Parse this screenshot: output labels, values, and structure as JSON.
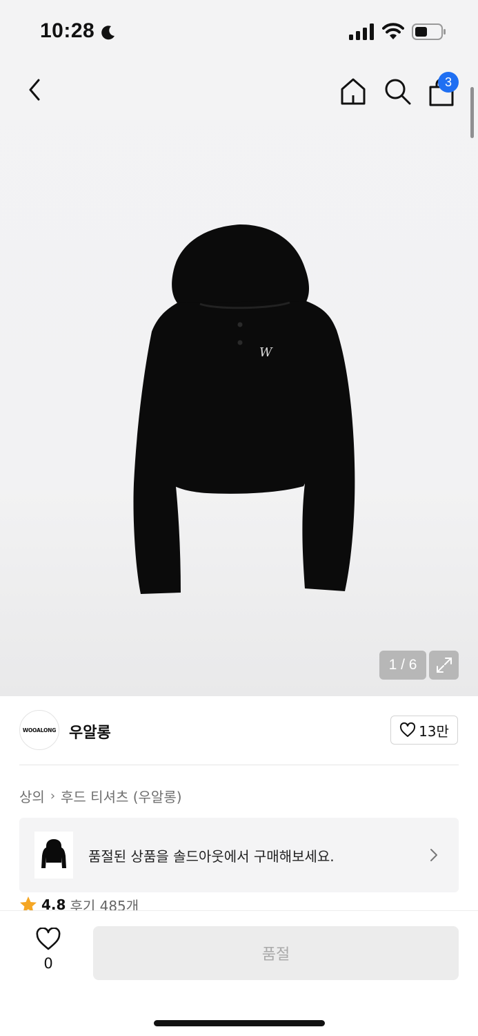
{
  "status_bar": {
    "time": "10:28",
    "icons": [
      "moon-icon",
      "signal-icon",
      "wifi-icon",
      "battery-icon"
    ]
  },
  "nav": {
    "icons": [
      "back-icon",
      "home-icon",
      "search-icon",
      "bag-icon"
    ],
    "cart_badge": "3"
  },
  "gallery": {
    "counter": "1 / 6",
    "expand_icon": "expand-icon"
  },
  "brand": {
    "logo_text": "WOOALONG",
    "name": "우알롱",
    "likes": "13만"
  },
  "breadcrumb": {
    "category": "상의",
    "subcategory": "후드 티셔츠 (우알롱)"
  },
  "soldout_banner": {
    "text": "품절된 상품을 솔드아웃에서 구매해보세요."
  },
  "rating": {
    "score": "4.8",
    "reviews": "후기 485개"
  },
  "bottom_bar": {
    "wish_count": "0",
    "buy_label": "품절"
  },
  "colors": {
    "badge": "#1f6ff2",
    "star": "#f5a623",
    "button_disabled": "#ececec"
  }
}
